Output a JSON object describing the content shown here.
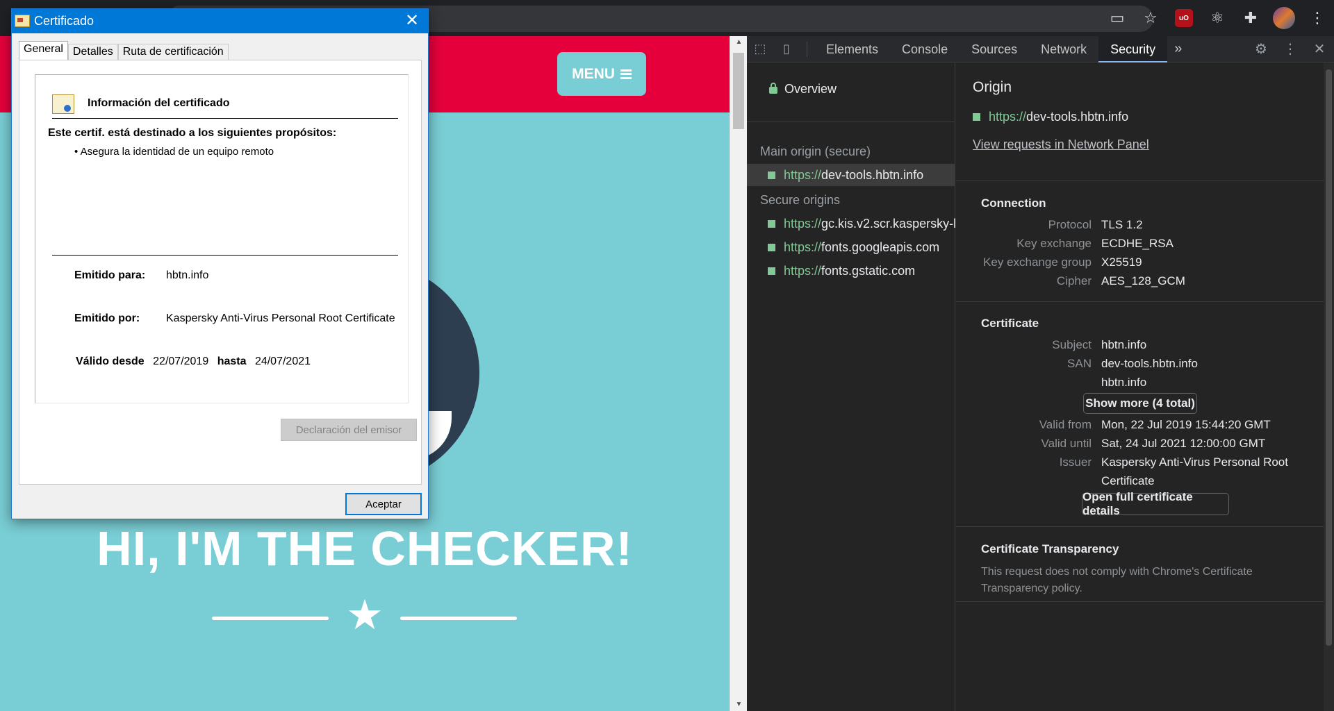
{
  "dialog": {
    "title": "Certificado",
    "tabs": [
      "General",
      "Detalles",
      "Ruta de certificación"
    ],
    "heading": "Información del certificado",
    "purpose_heading": "Este certif. está destinado a los siguientes propósitos:",
    "purpose_bullet": "• Asegura la identidad de un equipo remoto",
    "issued_to_label": "Emitido para:",
    "issued_to": "hbtn.info",
    "issued_by_label": "Emitido por:",
    "issued_by": "Kaspersky Anti-Virus Personal Root Certificate",
    "valid_from_label": "Válido desde",
    "valid_from": "22/07/2019",
    "valid_to_label": "hasta",
    "valid_to": "24/07/2021",
    "issuer_statement_button": "Declaración del emisor",
    "ok_button": "Aceptar"
  },
  "page": {
    "menu_label": "MENU",
    "hero_title": "HI, I'M THE CHECKER!"
  },
  "devtools": {
    "tabs": [
      "Elements",
      "Console",
      "Sources",
      "Network",
      "Security"
    ],
    "active_tab": "Security",
    "sidebar": {
      "overview": "Overview",
      "main_origin_label": "Main origin (secure)",
      "main_origin": {
        "scheme": "https://",
        "host": "dev-tools.hbtn.info"
      },
      "secure_origins_label": "Secure origins",
      "secure_origins": [
        {
          "scheme": "https://",
          "host": "gc.kis.v2.scr.kaspersky-l"
        },
        {
          "scheme": "https://",
          "host": "fonts.googleapis.com"
        },
        {
          "scheme": "https://",
          "host": "fonts.gstatic.com"
        }
      ]
    },
    "main": {
      "origin_title": "Origin",
      "origin_scheme": "https://",
      "origin_host": "dev-tools.hbtn.info",
      "view_requests_link": "View requests in Network Panel",
      "connection": {
        "title": "Connection",
        "rows": [
          {
            "k": "Protocol",
            "v": "TLS 1.2"
          },
          {
            "k": "Key exchange",
            "v": "ECDHE_RSA"
          },
          {
            "k": "Key exchange group",
            "v": "X25519"
          },
          {
            "k": "Cipher",
            "v": "AES_128_GCM"
          }
        ]
      },
      "certificate": {
        "title": "Certificate",
        "subject_k": "Subject",
        "subject_v": "hbtn.info",
        "san_k": "SAN",
        "san_v1": "dev-tools.hbtn.info",
        "san_v2": "hbtn.info",
        "show_more": "Show more (4 total)",
        "valid_from_k": "Valid from",
        "valid_from_v": "Mon, 22 Jul 2019 15:44:20 GMT",
        "valid_until_k": "Valid until",
        "valid_until_v": "Sat, 24 Jul 2021 12:00:00 GMT",
        "issuer_k": "Issuer",
        "issuer_v1": "Kaspersky Anti-Virus Personal Root",
        "issuer_v2": "Certificate",
        "open_details": "Open full certificate details"
      },
      "transparency": {
        "title": "Certificate Transparency",
        "text": "This request does not comply with Chrome's Certificate Transparency policy."
      }
    }
  },
  "colors": {
    "page_header": "#e5003c",
    "page_bg": "#79cdd4",
    "secure_green": "#81c995",
    "dialog_accent": "#0078d7"
  }
}
